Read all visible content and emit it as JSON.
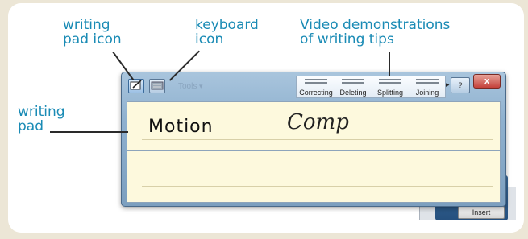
{
  "callouts": {
    "writing_pad_icon": [
      "writing",
      "pad icon"
    ],
    "keyboard_icon": [
      "keyboard",
      "icon"
    ],
    "video_tips": [
      "Video demonstrations",
      "of writing tips"
    ],
    "writing_pad": [
      "writing",
      "pad"
    ]
  },
  "window": {
    "tools_label": "Tools",
    "tips": [
      "Correcting",
      "Deleting",
      "Splitting",
      "Joining"
    ],
    "close_glyph": "x",
    "help_glyph": "?",
    "next_glyph": "▸",
    "caret_glyph": "▾",
    "writing_pad_icon": "pen-pad-icon",
    "keyboard_icon": "keyboard-icon"
  },
  "pad": {
    "printed_word": "Motion",
    "handwritten_word": "Comp"
  },
  "background_app": {
    "insert_label": "Insert"
  },
  "colors": {
    "callout_text": "#1a8bb5",
    "pad_background": "#fdf9dd",
    "page_background": "#ece6d6"
  }
}
